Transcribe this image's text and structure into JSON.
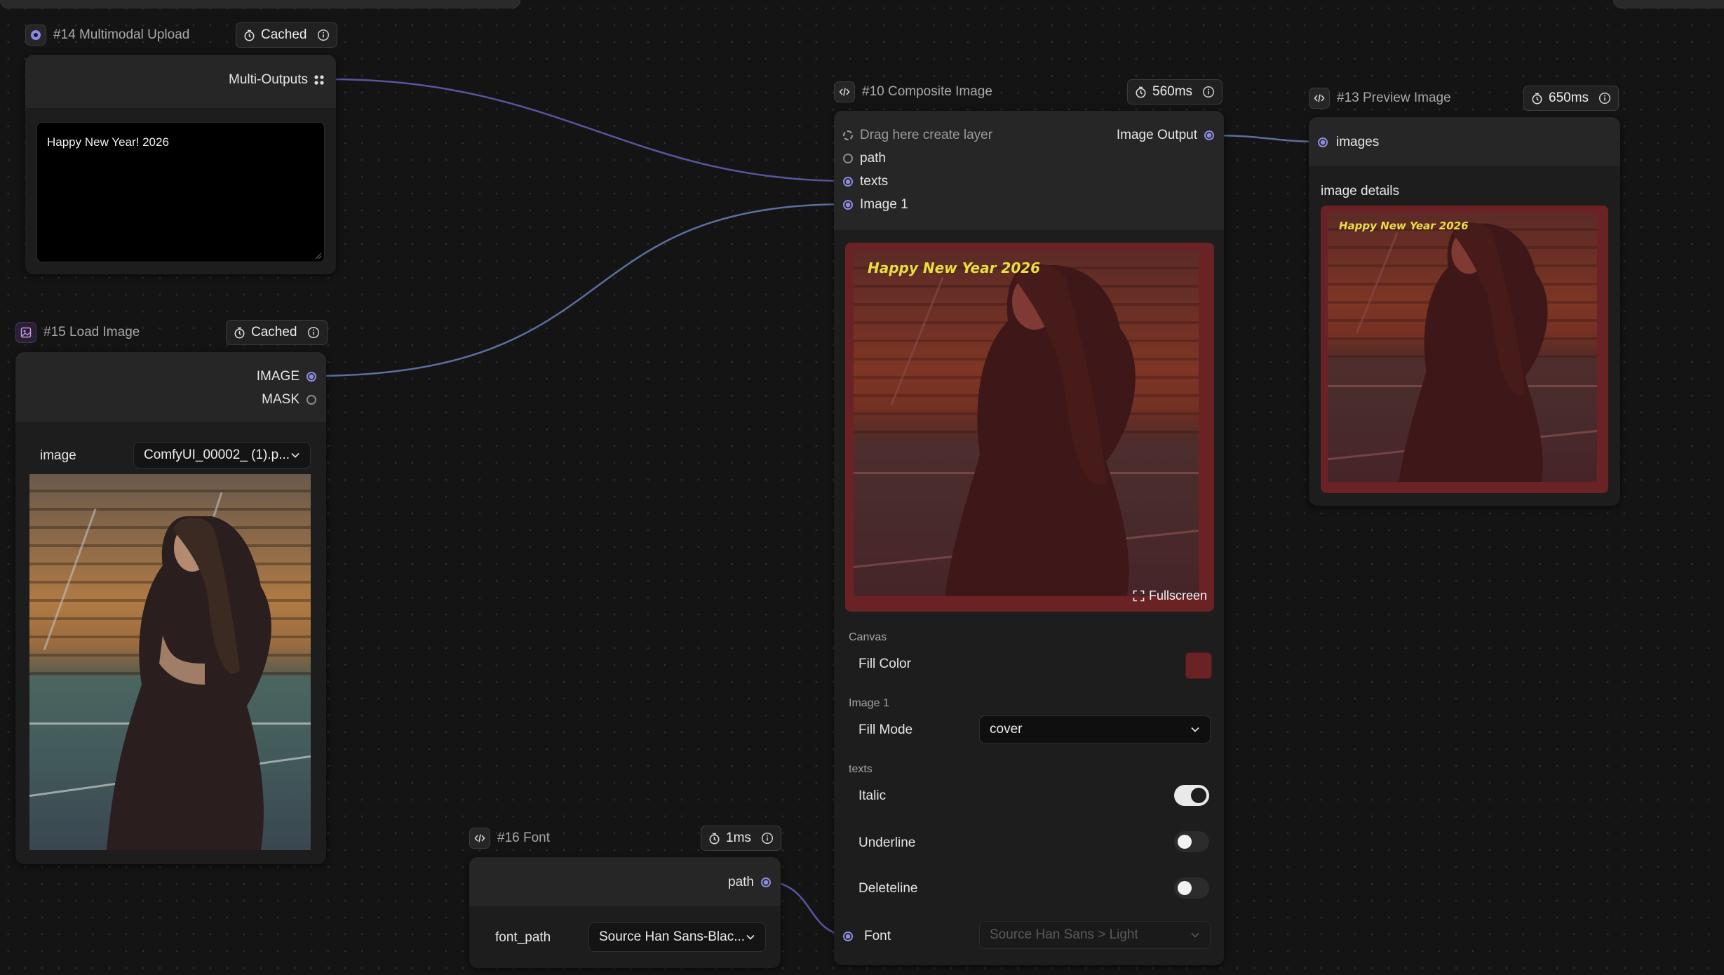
{
  "colors": {
    "canvas_bg": "#141414",
    "node_bg": "#1d1d1d",
    "port_active": "#8e8ce0",
    "wire": "#5a58a6",
    "fill_color_swatch": "#6b2225",
    "text_overlay": "#e8df3f"
  },
  "nodes": {
    "multimodal_upload": {
      "title": "#14 Multimodal Upload",
      "badge": "Cached",
      "icon": "circle-logo-icon",
      "output_label": "Multi-Outputs",
      "textarea_value": "Happy New Year! 2026"
    },
    "load_image": {
      "title": "#15 Load Image",
      "badge": "Cached",
      "icon": "image-icon",
      "outputs": [
        "IMAGE",
        "MASK"
      ],
      "image_label": "image",
      "image_select": "ComfyUI_00002_ (1).p..."
    },
    "composite_image": {
      "title": "#10 Composite Image",
      "badge": "560ms",
      "icon": "code-icon",
      "inputs": [
        "Drag here create layer",
        "path",
        "texts",
        "Image 1"
      ],
      "output_label": "Image Output",
      "overlay_text": "Happy New Year 2026",
      "fullscreen_label": "Fullscreen",
      "canvas_section": "Canvas",
      "fill_color_label": "Fill Color",
      "image1_section": "Image 1",
      "fill_mode_label": "Fill Mode",
      "fill_mode_value": "cover",
      "texts_section": "texts",
      "italic_label": "Italic",
      "italic_on": true,
      "underline_label": "Underline",
      "underline_on": false,
      "deleteline_label": "Deleteline",
      "deleteline_on": false,
      "font_label": "Font",
      "font_value": "Source Han Sans > Light"
    },
    "preview_image": {
      "title": "#13 Preview Image",
      "badge": "650ms",
      "icon": "code-icon",
      "input_label": "images",
      "details_label": "image details",
      "overlay_text": "Happy New Year 2026"
    },
    "font": {
      "title": "#16 Font",
      "badge": "1ms",
      "icon": "code-icon",
      "output_label": "path",
      "field_label": "font_path",
      "field_value": "Source Han Sans-Blac..."
    }
  }
}
